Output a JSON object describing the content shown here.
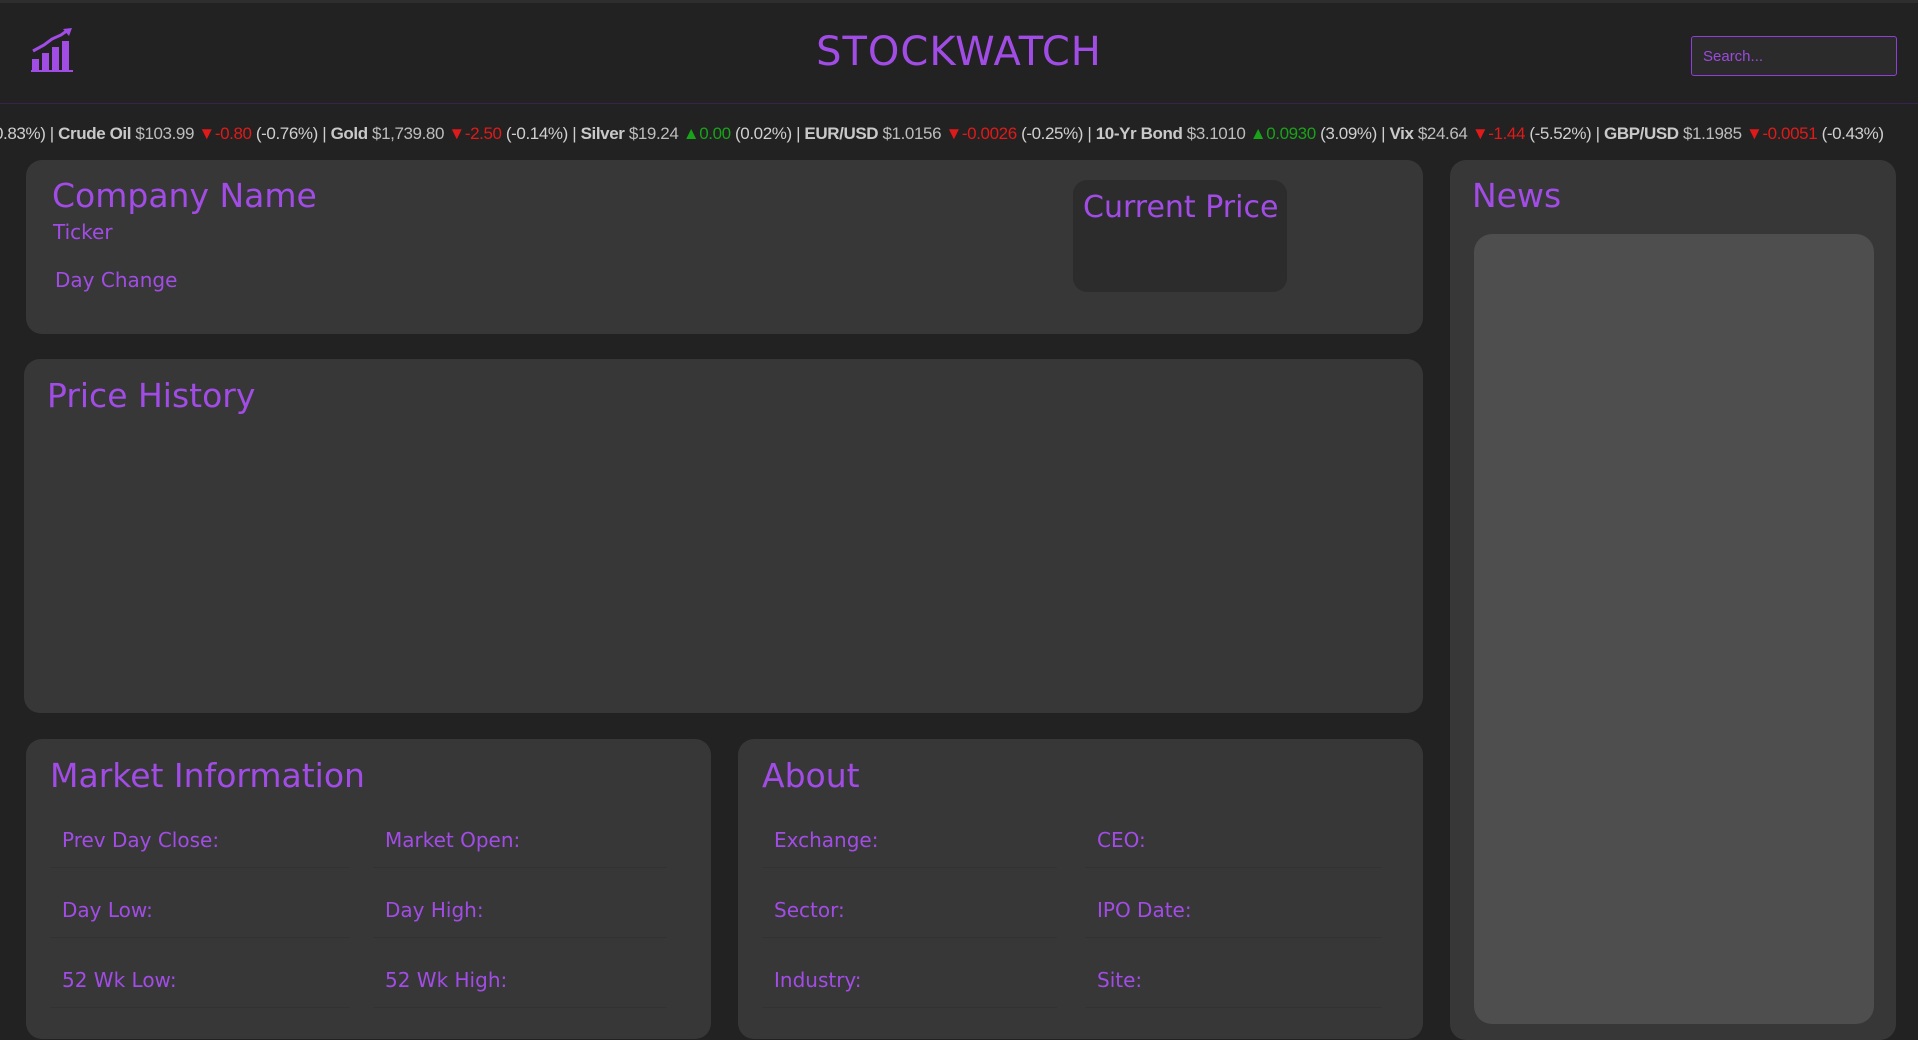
{
  "header": {
    "brand": "STOCKWATCH",
    "search_placeholder": "Search...",
    "logo_icon": "chart-growth-icon"
  },
  "ticker": [
    {
      "name": "",
      "price": "",
      "change": "",
      "pct": "0.83%)",
      "dir": "none",
      "partial": true
    },
    {
      "name": "Crude Oil",
      "price": "$103.99",
      "change": "-0.80",
      "pct": "(-0.76%)",
      "dir": "down"
    },
    {
      "name": "Gold",
      "price": "$1,739.80",
      "change": "-2.50",
      "pct": "(-0.14%)",
      "dir": "down"
    },
    {
      "name": "Silver",
      "price": "$19.24",
      "change": "0.00",
      "pct": "(0.02%)",
      "dir": "up"
    },
    {
      "name": "EUR/USD",
      "price": "$1.0156",
      "change": "-0.0026",
      "pct": "(-0.25%)",
      "dir": "down"
    },
    {
      "name": "10-Yr Bond",
      "price": "$3.1010",
      "change": "0.0930",
      "pct": "(3.09%)",
      "dir": "up"
    },
    {
      "name": "Vix",
      "price": "$24.64",
      "change": "-1.44",
      "pct": "(-5.52%)",
      "dir": "down"
    },
    {
      "name": "GBP/USD",
      "price": "$1.1985",
      "change": "-0.0051",
      "pct": "(-0.43%)",
      "dir": "down"
    }
  ],
  "company": {
    "name": "Company Name",
    "ticker": "Ticker",
    "day_change": "Day Change",
    "current_price_label": "Current Price"
  },
  "price_history": {
    "title": "Price History"
  },
  "market_info": {
    "title": "Market Information",
    "fields": [
      "Prev Day Close:",
      "Market Open:",
      "Day Low:",
      "Day High:",
      "52 Wk Low:",
      "52 Wk High:"
    ]
  },
  "about": {
    "title": "About",
    "fields": [
      "Exchange:",
      "CEO:",
      "Sector:",
      "IPO Date:",
      "Industry:",
      "Site:"
    ]
  },
  "news": {
    "title": "News"
  },
  "colors": {
    "accent": "#a24ce6",
    "up": "#19a319",
    "down": "#e01a1a",
    "background": "#222222",
    "card": "#373737"
  }
}
